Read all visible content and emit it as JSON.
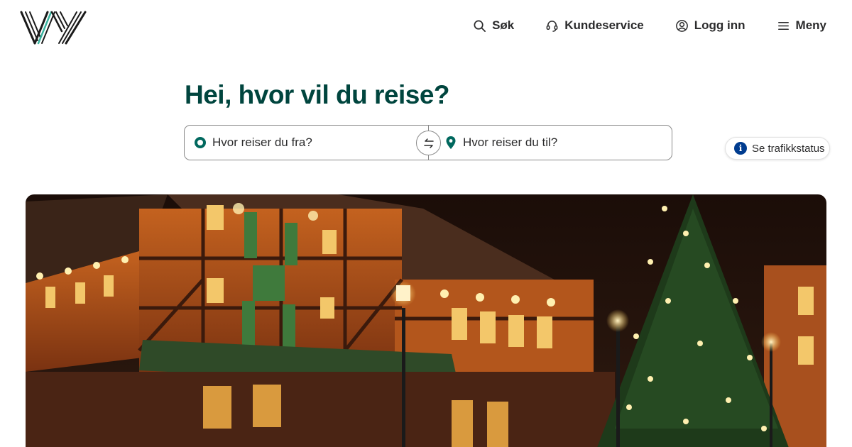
{
  "brand": {
    "logo_name": "Vy",
    "color": "#00453e",
    "accent": "#00685e"
  },
  "nav": {
    "search_label": "Søk",
    "customer_service_label": "Kundeservice",
    "login_label": "Logg inn",
    "menu_label": "Meny"
  },
  "main": {
    "heading": "Hei, hvor vil du reise?",
    "from_placeholder": "Hvor reiser du fra?",
    "to_placeholder": "Hvor reiser du til?",
    "traffic_status_label": "Se trafikkstatus"
  },
  "icons": [
    "search-icon",
    "headset-icon",
    "user-icon",
    "menu-icon",
    "swap-icon",
    "origin-icon",
    "location-pin-icon",
    "info-icon"
  ]
}
